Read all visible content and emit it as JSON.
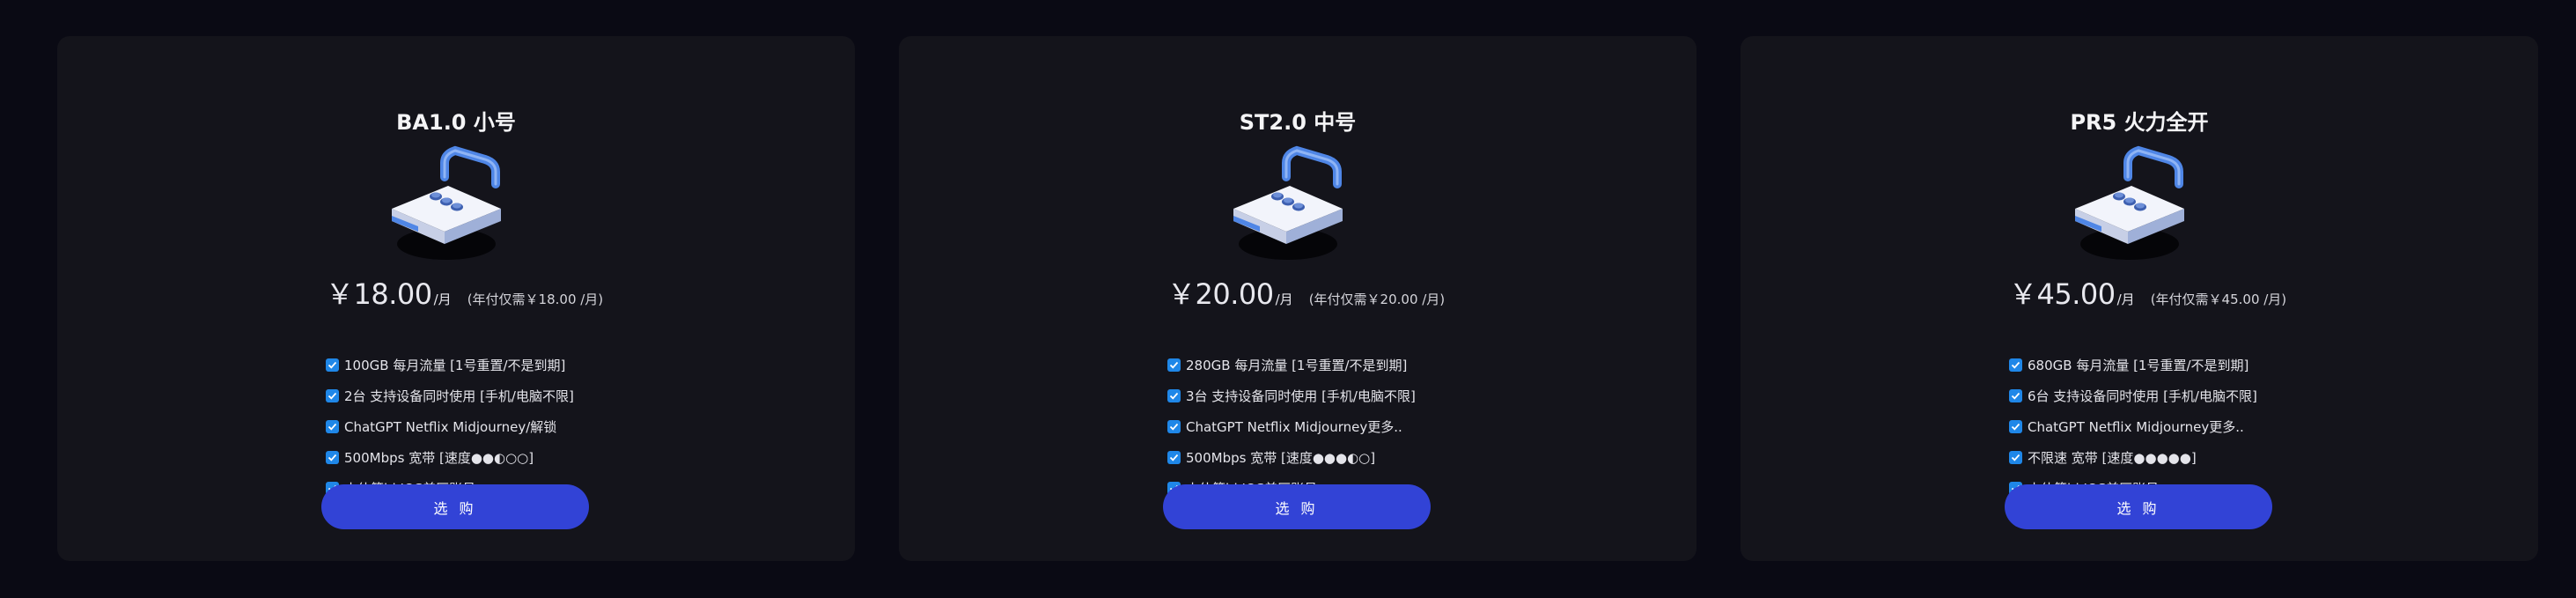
{
  "plans": [
    {
      "title": "BA1.0 小号",
      "price": "￥18.00",
      "unit": "/月",
      "annual": "(年付仅需￥18.00 /月)",
      "features": [
        "100GB 每月流量 [1号重置/不是到期]",
        "2台 支持设备同时使用 [手机/电脑不限]",
        "ChatGPT Netflix Midjourney/解锁",
        "500Mbps 宽带 [速度●●◐○○]",
        "小伙箭id IOS美区账号"
      ],
      "button": "选 购"
    },
    {
      "title": "ST2.0 中号",
      "price": "￥20.00",
      "unit": "/月",
      "annual": "(年付仅需￥20.00 /月)",
      "features": [
        "280GB 每月流量 [1号重置/不是到期]",
        "3台 支持设备同时使用 [手机/电脑不限]",
        "ChatGPT Netflix Midjourney更多..",
        "500Mbps 宽带 [速度●●●◐○]",
        "小伙箭id IOS美区账号"
      ],
      "button": "选 购"
    },
    {
      "title": "PR5 火力全开",
      "price": "￥45.00",
      "unit": "/月",
      "annual": "(年付仅需￥45.00 /月)",
      "features": [
        "680GB 每月流量 [1号重置/不是到期]",
        "6台 支持设备同时使用 [手机/电脑不限]",
        "ChatGPT Netflix Midjourney更多..",
        "不限速 宽带 [速度●●●●●]",
        "小伙箭id IOS美区账号"
      ],
      "button": "选 购"
    }
  ],
  "icons": {
    "illustration": "padlock-icon",
    "feature": "checkbox-checked-icon"
  },
  "colors": {
    "background": "#0a0a14",
    "card": "#14141b",
    "button": "#3243d6",
    "check": "#1f87e8",
    "lock_shackle": "#4f86e6"
  }
}
